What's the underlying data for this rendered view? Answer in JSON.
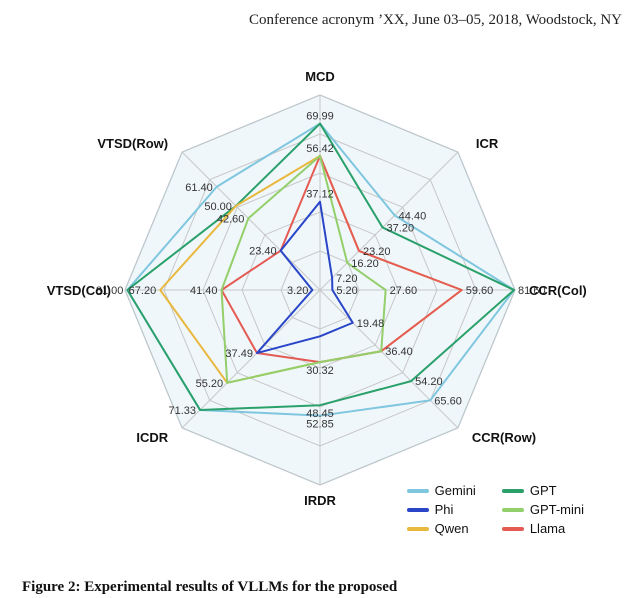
{
  "header": {
    "conference_line": "Conference acronym ’XX, June 03–05, 2018, Woodstock, NY"
  },
  "caption_prefix": "Figure 2: Experimental results of VLLMs for the proposed",
  "chart_data": {
    "type": "radar",
    "axes": [
      "MCD",
      "ICR",
      "CCR(Col)",
      "CCR(Row)",
      "IRDR",
      "ICDR",
      "VTSD(Col)",
      "VTSD(Row)"
    ],
    "rlim": [
      0,
      82
    ],
    "rings": 5,
    "tick_values": {
      "MCD": [
        69.99,
        56.42,
        37.12
      ],
      "ICR": [
        44.4,
        37.2,
        23.2,
        16.2,
        7.2
      ],
      "CCR(Col)": [
        81.6,
        59.6,
        27.6,
        5.2
      ],
      "CCR(Row)": [
        65.6,
        54.2,
        36.4,
        19.48
      ],
      "IRDR": [
        52.85,
        48.45,
        30.32
      ],
      "ICDR": [
        71.33,
        55.2,
        37.49
      ],
      "VTSD(Col)": [
        81.0,
        67.2,
        41.4,
        3.2
      ],
      "VTSD(Row)": [
        61.4,
        50.0,
        42.6,
        23.4
      ]
    },
    "series": [
      {
        "name": "Gemini",
        "color": "#7fc6df",
        "values": [
          69.99,
          44.4,
          81.6,
          65.6,
          52.85,
          71.33,
          81.0,
          61.4
        ]
      },
      {
        "name": "GPT",
        "color": "#2aa06a",
        "values": [
          69.99,
          37.2,
          81.6,
          54.2,
          48.45,
          71.33,
          81.0,
          50.0
        ]
      },
      {
        "name": "Phi",
        "color": "#2945c8",
        "values": [
          37.12,
          7.2,
          5.2,
          19.48,
          19.48,
          37.49,
          3.2,
          23.4
        ]
      },
      {
        "name": "GPT-mini",
        "color": "#93cf6a",
        "values": [
          56.42,
          16.2,
          27.6,
          36.4,
          30.32,
          55.2,
          41.4,
          42.6
        ]
      },
      {
        "name": "Qwen",
        "color": "#e9b83f",
        "values": [
          56.42,
          23.2,
          59.6,
          36.4,
          30.32,
          55.2,
          67.2,
          50.0
        ]
      },
      {
        "name": "Llama",
        "color": "#e45b54",
        "values": [
          56.42,
          23.2,
          59.6,
          36.4,
          30.32,
          37.49,
          41.4,
          23.4
        ]
      }
    ],
    "legend_order": [
      "Gemini",
      "GPT",
      "Phi",
      "GPT-mini",
      "Qwen",
      "Llama"
    ],
    "legend_layout": [
      [
        "Gemini",
        "GPT"
      ],
      [
        "Phi",
        "GPT-mini"
      ],
      [
        "Qwen",
        "Llama"
      ]
    ]
  }
}
